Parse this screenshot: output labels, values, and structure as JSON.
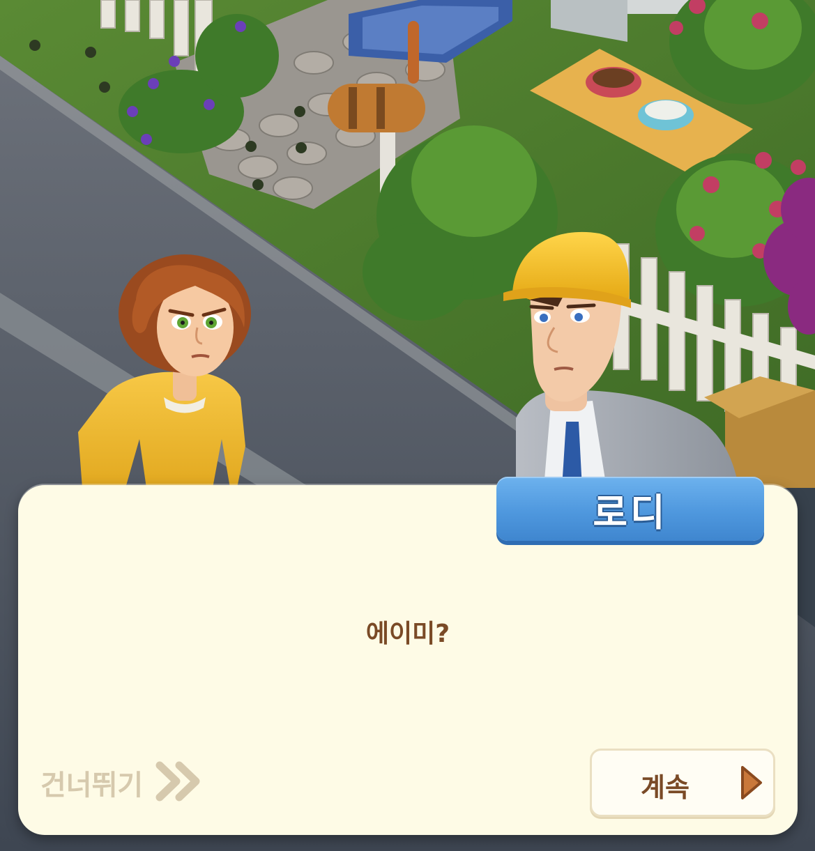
{
  "dialog": {
    "speaker_name": "로디",
    "message": "에이미?",
    "skip_label": "건너뛰기",
    "continue_label": "계속"
  },
  "characters": {
    "left": "woman-with-red-hair",
    "right": "man-with-hard-hat"
  },
  "colors": {
    "dialog_background": "#fefbe6",
    "name_tab": "#4f98de",
    "dialog_text": "#7a4a26",
    "skip_text": "#d6c9ad",
    "continue_arrow": "#c9783a"
  },
  "icons": {
    "skip": "double-chevron-right-icon",
    "continue": "play-arrow-icon"
  }
}
